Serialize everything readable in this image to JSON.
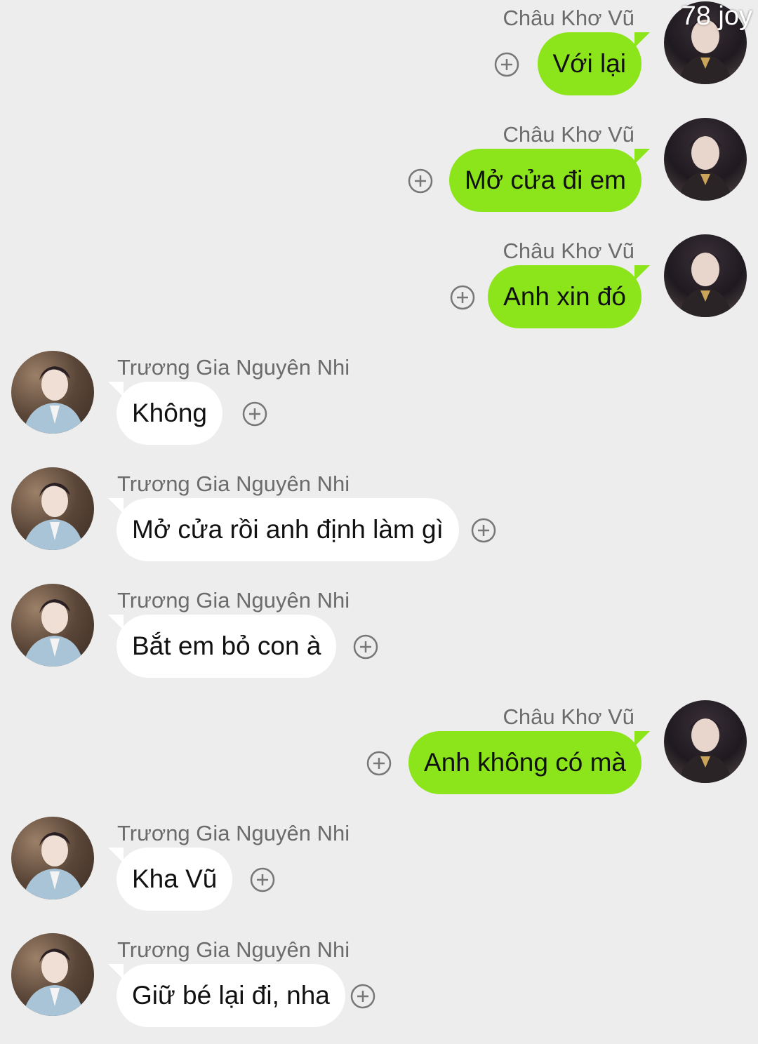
{
  "watermark": "78 joy",
  "messages": [
    {
      "side": "me",
      "sender": "Châu Khơ Vũ",
      "text": "Với lại"
    },
    {
      "side": "me",
      "sender": "Châu Khơ Vũ",
      "text": "Mở cửa đi em"
    },
    {
      "side": "me",
      "sender": "Châu Khơ Vũ",
      "text": "Anh xin đó"
    },
    {
      "side": "them",
      "sender": "Trương Gia Nguyên Nhi",
      "text": "Không"
    },
    {
      "side": "them",
      "sender": "Trương Gia Nguyên Nhi",
      "text": "Mở cửa rồi anh định làm gì"
    },
    {
      "side": "them",
      "sender": "Trương Gia Nguyên Nhi",
      "text": "Bắt em bỏ con à"
    },
    {
      "side": "me",
      "sender": "Châu Khơ Vũ",
      "text": "Anh không có mà"
    },
    {
      "side": "them",
      "sender": "Trương Gia Nguyên Nhi",
      "text": "Kha Vũ"
    },
    {
      "side": "them",
      "sender": "Trương Gia Nguyên Nhi",
      "text": "Giữ bé lại đi, nha"
    }
  ],
  "colors": {
    "background": "#ededed",
    "outgoing_bubble": "#8ce51a",
    "incoming_bubble": "#ffffff",
    "sender_text": "#6b6b6b"
  },
  "icons": {
    "add": "plus-circle-icon",
    "avatar_me": "avatar-chau-kho-vu",
    "avatar_them": "avatar-truong-gia-nguyen-nhi"
  }
}
